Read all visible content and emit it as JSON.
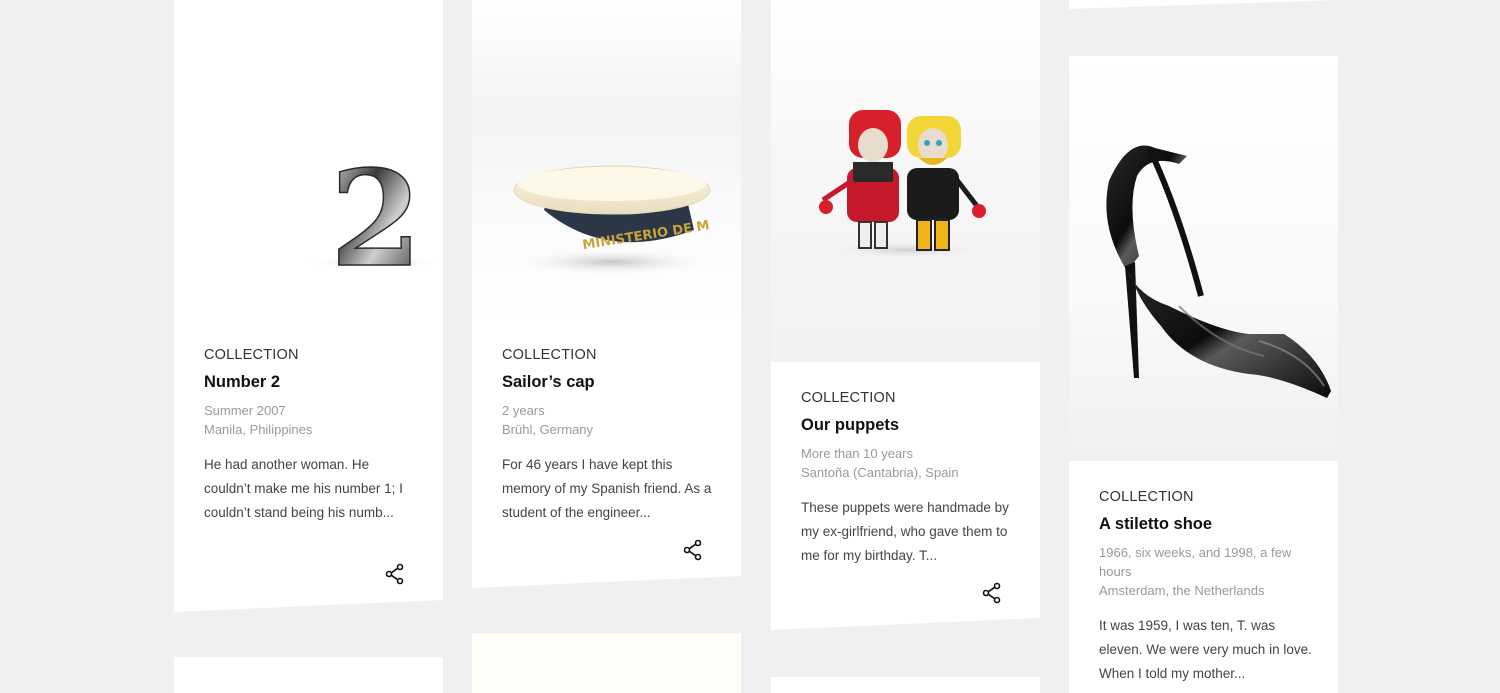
{
  "cards": [
    {
      "kicker": "COLLECTION",
      "title": "Number 2",
      "meta": [
        "Summer 2007",
        "Manila, Philippines"
      ],
      "excerpt": "He had another woman. He couldn’t make me his number 1; I couldn’t stand being his numb...",
      "share_icon": "share-icon",
      "image_subject": "Chrome numeral 2",
      "image_text": "2"
    },
    {
      "kicker": "COLLECTION",
      "title": "Sailor’s cap",
      "meta": [
        "2 years",
        "Brühl, Germany"
      ],
      "excerpt": "For 46 years I have kept this memory of my Spanish friend. As a student of the engineer...",
      "share_icon": "share-icon",
      "image_subject": "Sailor cap with band lettering",
      "image_text": "MINISTERIO DE M"
    },
    {
      "kicker": "COLLECTION",
      "title": "Our puppets",
      "meta": [
        "More than 10 years",
        "Santoña (Cantabria), Spain"
      ],
      "excerpt": "These puppets were handmade by my ex-girlfriend, who gave them to me for my birthday. T...",
      "share_icon": "share-icon",
      "image_subject": "Two handmade puppets"
    },
    {
      "kicker": "COLLECTION",
      "title": "A stiletto shoe",
      "meta": [
        "1966, six weeks, and 1998, a few hours",
        "Amsterdam, the Netherlands"
      ],
      "excerpt": "It was 1959, I was ten, T. was eleven. We were very much in love. When I told my mother...",
      "image_subject": "Black patent stiletto shoe"
    }
  ],
  "colors": {
    "background": "#f0f0f0",
    "card": "#ffffff",
    "meta": "#9a9a9a",
    "text": "#444444"
  }
}
